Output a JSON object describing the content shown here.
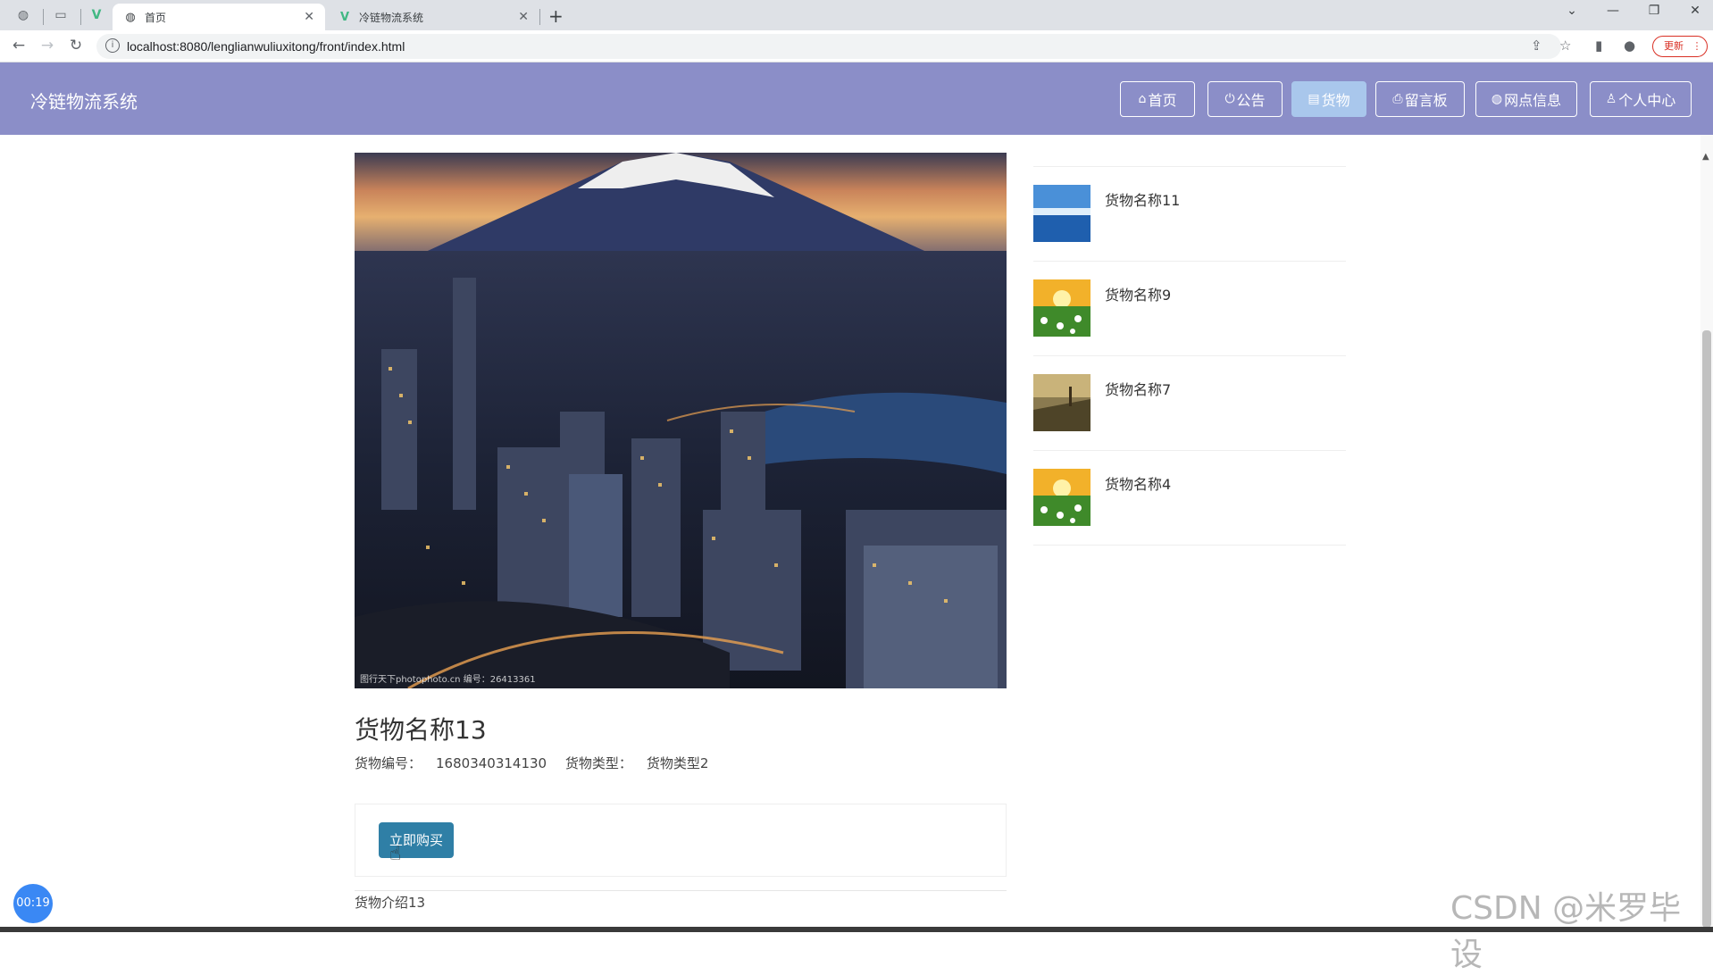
{
  "browser": {
    "tabs": [
      {
        "title": "首页",
        "active": true
      },
      {
        "title": "冷链物流系统",
        "active": false
      }
    ],
    "url": "localhost:8080/lenglianwuliuxitong/front/index.html",
    "update_label": "更新"
  },
  "header": {
    "brand": "冷链物流系统",
    "nav": [
      {
        "label": "首页",
        "icon": "home-icon",
        "active": false
      },
      {
        "label": "公告",
        "icon": "power-icon",
        "active": false
      },
      {
        "label": "货物",
        "icon": "box-icon",
        "active": true
      },
      {
        "label": "留言板",
        "icon": "printer-icon",
        "active": false
      },
      {
        "label": "网点信息",
        "icon": "globe-icon",
        "active": false
      },
      {
        "label": "个人中心",
        "icon": "user-icon",
        "active": false
      }
    ]
  },
  "product": {
    "image_watermark": "图行天下photophoto.cn 编号：26413361",
    "name": "货物名称13",
    "code_label": "货物编号：",
    "code_value": "1680340314130",
    "type_label": "货物类型：",
    "type_value": "货物类型2",
    "buy_label": "立即购买",
    "intro": "货物介绍13"
  },
  "sidebar": {
    "items": [
      {
        "name": "货物名称11",
        "thumb": "sea"
      },
      {
        "name": "货物名称9",
        "thumb": "flowers"
      },
      {
        "name": "货物名称7",
        "thumb": "field"
      },
      {
        "name": "货物名称4",
        "thumb": "flowers"
      }
    ]
  },
  "overlay": {
    "timer": "00:19",
    "watermark": "CSDN @米罗毕设"
  },
  "colors": {
    "header_bg": "#8b8ec8",
    "nav_active_bg": "#a9c7ec",
    "buy_button": "#2f7fa6"
  }
}
